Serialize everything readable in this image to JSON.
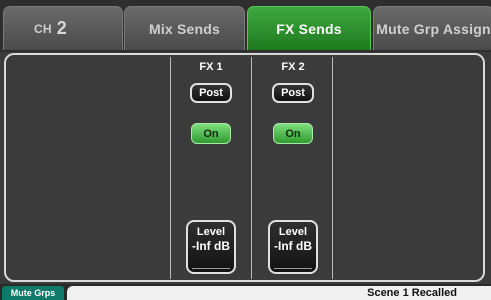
{
  "tabs": {
    "channel": {
      "prefix": "CH",
      "number": "2"
    },
    "mix_sends": "Mix Sends",
    "fx_sends": "FX Sends",
    "mute_grp_assign": "Mute Grp Assign"
  },
  "active_tab": "FX Sends",
  "fx_sends": [
    {
      "label": "FX 1",
      "tap": "Post",
      "on": "On",
      "level_label": "Level",
      "level_value": "-Inf dB"
    },
    {
      "label": "FX 2",
      "tap": "Post",
      "on": "On",
      "level_label": "Level",
      "level_value": "-Inf dB"
    }
  ],
  "status_bar": {
    "mute_grps": "Mute Grps",
    "message": "Scene 1 Recalled"
  },
  "colors": {
    "active_tab": "#2e8f2e",
    "on_button": "#5cc65c",
    "mute_grps_tab": "#0f7a6a",
    "panel_background": "#3b3b3b"
  }
}
